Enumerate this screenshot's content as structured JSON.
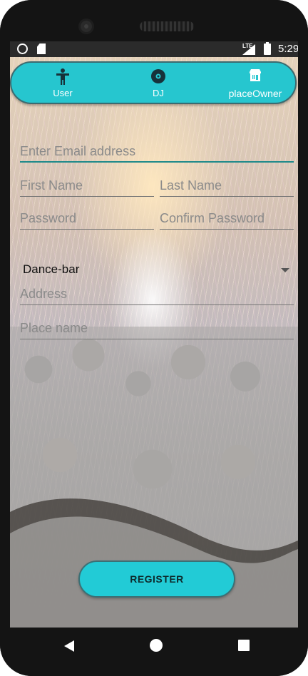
{
  "status_bar": {
    "network": "LTE",
    "time": "5:29"
  },
  "roles": [
    {
      "label": "User",
      "icon": "person-icon"
    },
    {
      "label": "DJ",
      "icon": "disc-icon"
    },
    {
      "label": "placeOwner",
      "icon": "storefront-icon"
    }
  ],
  "form": {
    "email_placeholder": "Enter Email address",
    "first_name_placeholder": "First Name",
    "last_name_placeholder": "Last Name",
    "password_placeholder": "Password",
    "confirm_password_placeholder": "Confirm Password",
    "place_type_selected": "Dance-bar",
    "address_placeholder": "Address",
    "place_name_placeholder": "Place name"
  },
  "register_label": "REGISTER",
  "colors": {
    "accent": "#26c6cf",
    "field_focus": "#1f8a8a"
  }
}
